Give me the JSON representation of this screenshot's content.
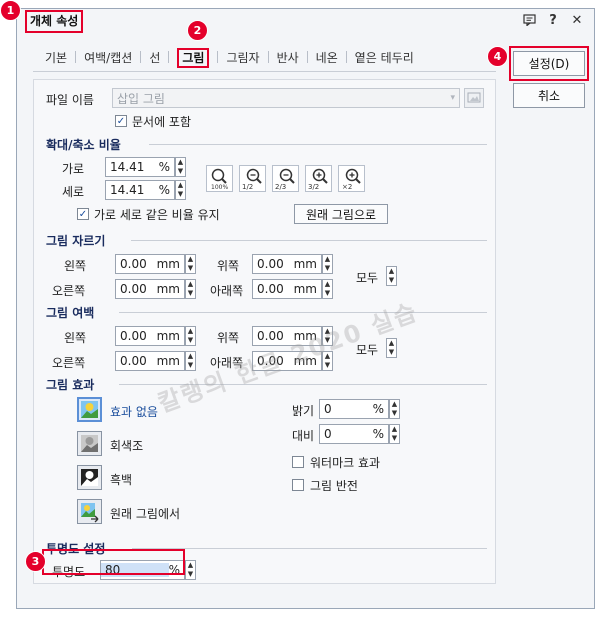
{
  "window": {
    "title": "개체 속성",
    "icons": [
      "message-icon",
      "help-icon",
      "close-icon"
    ]
  },
  "badges": [
    "1",
    "2",
    "3",
    "4"
  ],
  "tabs": [
    {
      "label": "기본"
    },
    {
      "label": "여백/캡션"
    },
    {
      "label": "선"
    },
    {
      "label": "그림",
      "active": true
    },
    {
      "label": "그림자"
    },
    {
      "label": "반사"
    },
    {
      "label": "네온"
    },
    {
      "label": "옅은 테두리"
    }
  ],
  "buttons": {
    "ok": "설정(D)",
    "cancel": "취소",
    "original_size": "원래 그림으로"
  },
  "file": {
    "label": "파일 이름",
    "placeholder": "삽입 그림",
    "include_in_doc": "문서에 포함",
    "include_checked": true
  },
  "scale": {
    "title": "확대/축소 비율",
    "width_label": "가로",
    "width_value": "14.41",
    "height_label": "세로",
    "height_value": "14.41",
    "unit": "%",
    "keep_ratio_label": "가로 세로 같은 비율 유지",
    "keep_ratio_checked": true,
    "zoom_labels": [
      "100%",
      "1/2",
      "2/3",
      "3/2",
      "×2"
    ]
  },
  "crop": {
    "title": "그림 자르기",
    "left_label": "왼쪽",
    "left_value": "0.00",
    "right_label": "오른쪽",
    "right_value": "0.00",
    "top_label": "위쪽",
    "top_value": "0.00",
    "bottom_label": "아래쪽",
    "bottom_value": "0.00",
    "unit": "mm",
    "all_label": "모두"
  },
  "margin": {
    "title": "그림 여백",
    "left_label": "왼쪽",
    "left_value": "0.00",
    "right_label": "오른쪽",
    "right_value": "0.00",
    "top_label": "위쪽",
    "top_value": "0.00",
    "bottom_label": "아래쪽",
    "bottom_value": "0.00",
    "unit": "mm",
    "all_label": "모두"
  },
  "effects": {
    "title": "그림 효과",
    "options": [
      "효과 없음",
      "회색조",
      "흑백",
      "원래 그림에서"
    ],
    "brightness_label": "밝기",
    "brightness_value": "0",
    "contrast_label": "대비",
    "contrast_value": "0",
    "unit": "%",
    "watermark_label": "워터마크 효과",
    "invert_label": "그림 반전"
  },
  "transparency": {
    "title": "투명도 설정",
    "label": "투명도",
    "value": "80",
    "unit": "%"
  },
  "watermark_text": "칼랭의 한글 2020 실습",
  "colors": {
    "accent": "#e4002b",
    "section_title": "#1a2c5e",
    "border": "#9aa7b8"
  }
}
